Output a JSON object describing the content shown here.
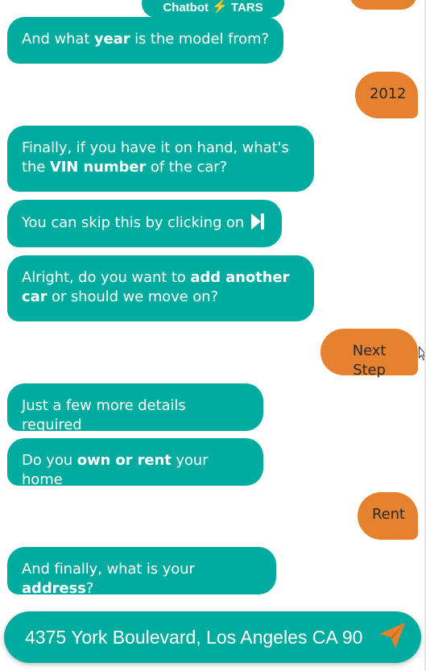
{
  "branding": {
    "name": "Chatbot",
    "bolt": "⚡",
    "brand": "TARS"
  },
  "messages": {
    "m1": {
      "pre": "And what ",
      "bold": "year",
      "post": " is the model from?"
    },
    "r1": "2012",
    "m2": {
      "line1": "Finally, if you have it on hand, what's",
      "line2_pre": "the ",
      "line2_bold": "VIN number",
      "line2_post": " of the car?"
    },
    "m3": {
      "text": "You can skip this by clicking on"
    },
    "m4": {
      "line1_pre": "Alright, do you want to ",
      "line1_bold": "add another",
      "line2_bold": "car",
      "line2_post": " or should we move on?"
    },
    "r2": "Next Step",
    "m5": "Just a few more details required",
    "m6": {
      "pre": "Do you ",
      "bold": "own or rent",
      "post": " your home"
    },
    "r3": "Rent",
    "m7": {
      "pre": "And finally, what is your ",
      "bold": "address",
      "post": "?"
    }
  },
  "input": {
    "value": "4375 York Boulevard, Los Angeles CA 90",
    "placeholder": ""
  },
  "icons": {
    "send": "send-paper-plane-icon",
    "skip": "skip-next-icon",
    "cursor": "mouse-pointer-icon"
  },
  "colors": {
    "bot_bubble": "#00ab9f",
    "user_bubble": "#e5812f",
    "bot_text": "#ffffff",
    "user_text": "#2a2a2a",
    "bolt": "#f5b400"
  }
}
